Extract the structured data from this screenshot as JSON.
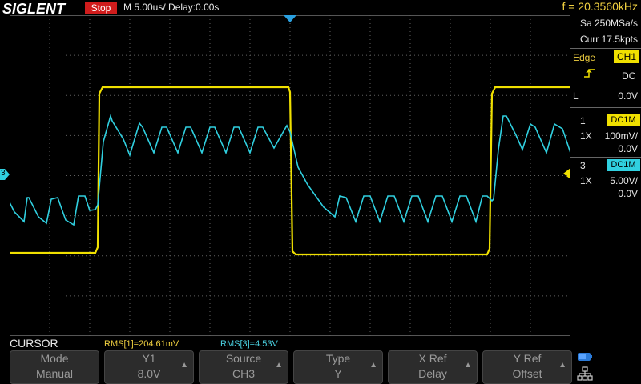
{
  "header": {
    "logo": "SIGLENT",
    "run_state": "Stop",
    "timebase_text": "M 5.00us/",
    "delay_text": "Delay:0.00s",
    "frequency": "f = 20.3560kHz"
  },
  "acquisition": {
    "sample_rate": "Sa 250MSa/s",
    "memory_depth": "Curr 17.5kpts"
  },
  "trigger": {
    "type": "Edge",
    "source": "CH1",
    "coupling": "DC",
    "level_label": "L",
    "level_value": "0.0V",
    "slope_icon": "rising-edge-icon"
  },
  "channels": [
    {
      "number": "1",
      "coupling": "DC1M",
      "probe": "1X",
      "scale": "100mV/",
      "offset": "0.0V",
      "color": "#f0e000"
    },
    {
      "number": "3",
      "coupling": "DC1M",
      "probe": "1X",
      "scale": "5.00V/",
      "offset": "0.0V",
      "color": "#30d0e0"
    }
  ],
  "markers": {
    "ch3_ground_label": "3"
  },
  "menu": {
    "title": "CURSOR",
    "softkeys": [
      {
        "label": "Mode",
        "value": "Manual",
        "arrow": ""
      },
      {
        "label": "Y1",
        "value": "8.0V",
        "arrow": "▲"
      },
      {
        "label": "Source",
        "value": "CH3",
        "arrow": "▲"
      },
      {
        "label": "Type",
        "value": "Y",
        "arrow": "▲"
      },
      {
        "label": "X Ref",
        "value": "Delay",
        "arrow": "▲"
      },
      {
        "label": "Y Ref",
        "value": "Offset",
        "arrow": "▲"
      }
    ]
  },
  "measurements": {
    "rms1": "RMS[1]=204.61mV",
    "rms3": "RMS[3]=4.53V"
  },
  "colors": {
    "ch1": "#f0e000",
    "ch3": "#30d0e0",
    "grid_dots": "#606060",
    "stop_badge": "#d01c1c"
  },
  "icons": {
    "usb": "usb-icon",
    "network": "network-icon"
  }
}
